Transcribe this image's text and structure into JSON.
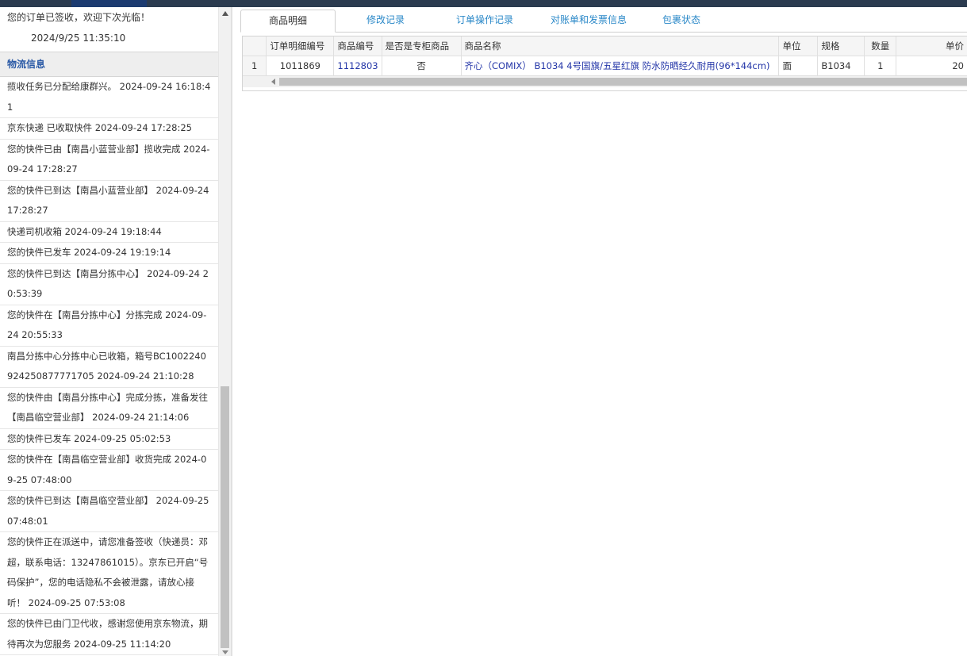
{
  "signed": {
    "message": "您的订单已签收，欢迎下次光临！",
    "time": "2024/9/25 11:35:10"
  },
  "logistics": {
    "heading": "物流信息",
    "entries": [
      "揽收任务已分配给康群兴。 2024-09-24 16:18:41",
      "京东快递 已收取快件 2024-09-24 17:28:25",
      "您的快件已由【南昌小蓝营业部】揽收完成 2024-09-24 17:28:27",
      "您的快件已到达【南昌小蓝营业部】 2024-09-24 17:28:27",
      "快递司机收箱 2024-09-24 19:18:44",
      "您的快件已发车 2024-09-24 19:19:14",
      "您的快件已到达【南昌分拣中心】 2024-09-24 20:53:39",
      "您的快件在【南昌分拣中心】分拣完成 2024-09-24 20:55:33",
      "南昌分拣中心分拣中心已收箱，箱号BC1002240924250877771705 2024-09-24 21:10:28",
      "您的快件由【南昌分拣中心】完成分拣，准备发往【南昌临空营业部】 2024-09-24 21:14:06",
      "您的快件已发车 2024-09-25 05:02:53",
      "您的快件在【南昌临空营业部】收货完成 2024-09-25 07:48:00",
      "您的快件已到达【南昌临空营业部】 2024-09-25 07:48:01",
      "您的快件正在派送中，请您准备签收（快递员：邓超，联系电话：13247861015）。京东已开启“号码保护”，您的电话隐私不会被泄露，请放心接听！ 2024-09-25 07:53:08",
      "您的快件已由门卫代收，感谢您使用京东物流，期待再次为您服务 2024-09-25 11:14:20"
    ]
  },
  "tabs": [
    "商品明细",
    "修改记录",
    "订单操作记录",
    "对账单和发票信息",
    "包裹状态"
  ],
  "table": {
    "columns": [
      "",
      "订单明细编号",
      "商品编号",
      "是否是专柜商品",
      "商品名称",
      "单位",
      "规格",
      "数量",
      "单价"
    ],
    "rows": [
      [
        "1",
        "1011869",
        "1112803",
        "否",
        "齐心（COMIX） B1034 4号国旗/五星红旗 防水防晒经久耐用(96*144cm)",
        "面",
        "B1034",
        "1",
        "20"
      ]
    ]
  }
}
